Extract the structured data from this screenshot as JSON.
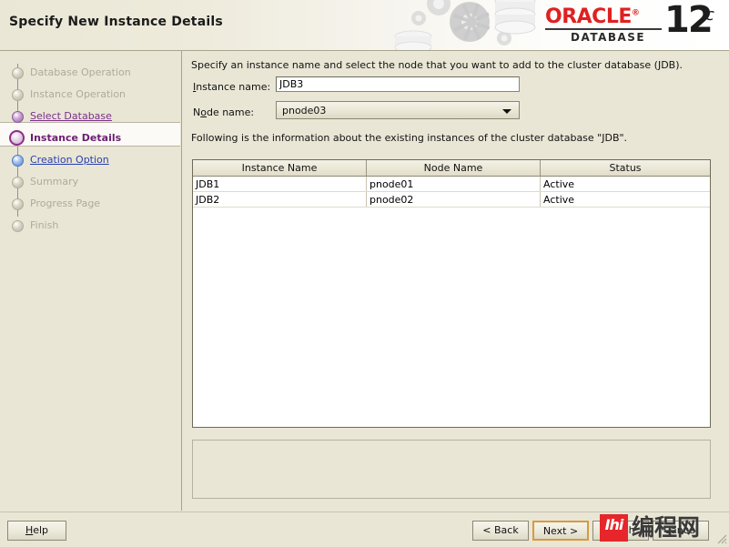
{
  "header": {
    "title": "Specify New Instance Details",
    "brand": {
      "oracle": "ORACLE",
      "registered": "®",
      "database": "DATABASE",
      "version": "12",
      "version_suffix": "c"
    }
  },
  "sidebar": {
    "items": [
      {
        "label": "Database Operation",
        "state": "done"
      },
      {
        "label": "Instance Operation",
        "state": "done"
      },
      {
        "label": "Select Database",
        "state": "visited"
      },
      {
        "label": "Instance Details",
        "state": "active"
      },
      {
        "label": "Creation Option",
        "state": "next"
      },
      {
        "label": "Summary",
        "state": "done"
      },
      {
        "label": "Progress Page",
        "state": "done"
      },
      {
        "label": "Finish",
        "state": "done"
      }
    ]
  },
  "main": {
    "intro_text": "Specify an instance name and select the node that you want to add to the cluster database (JDB).",
    "instance_name_label": "Instance name:",
    "instance_name_value": "JDB3",
    "node_name_label": "Node name:",
    "node_name_value": "pnode03",
    "node_name_options": [
      "pnode03"
    ],
    "table_caption": "Following is the information about the existing instances of the cluster database \"JDB\".",
    "table": {
      "columns": [
        "Instance Name",
        "Node Name",
        "Status"
      ],
      "rows": [
        [
          "JDB1",
          "pnode01",
          "Active"
        ],
        [
          "JDB2",
          "pnode02",
          "Active"
        ]
      ]
    },
    "message_panel_text": ""
  },
  "buttons": {
    "help": "Help",
    "back": "< Back",
    "next": "Next >",
    "finish": "Finish",
    "cancel": "Cancel"
  },
  "watermark": {
    "badge": "Ihi",
    "text": "编程网"
  },
  "colors": {
    "background": "#e9e6d5",
    "accent_active": "#6b1f72",
    "link_purple": "#7a2f8a",
    "link_blue": "#2a3fae",
    "focus_border": "#d79b3c",
    "oracle_red": "#e02020",
    "watermark_red": "#e6262a"
  }
}
